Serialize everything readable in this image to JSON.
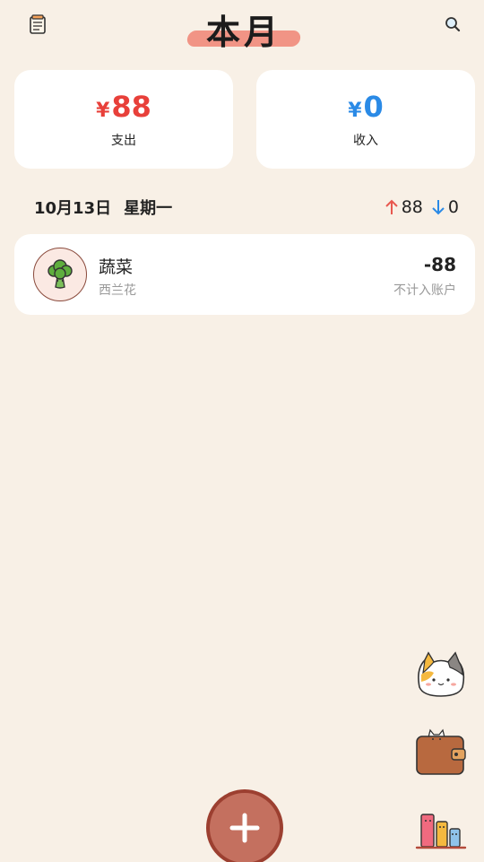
{
  "header": {
    "title": "本月",
    "menu_icon": "notebook-icon",
    "search_icon": "search-icon"
  },
  "summary": {
    "expense": {
      "currency": "¥",
      "amount": "88",
      "label": "支出",
      "color": "#e8403a"
    },
    "income": {
      "currency": "¥",
      "amount": "0",
      "label": "收入",
      "color": "#2a8ae6"
    }
  },
  "day": {
    "date": "10月13日",
    "weekday": "星期一",
    "expense_total": "88",
    "income_total": "0",
    "expense_arrow_color": "#e8584f",
    "income_arrow_color": "#2a8ae6"
  },
  "entries": [
    {
      "icon": "broccoli-icon",
      "category": "蔬菜",
      "note": "西兰花",
      "amount": "-88",
      "flag": "不计入账户"
    }
  ],
  "side_icons": [
    "cat-icon",
    "wallet-icon",
    "chart-icon"
  ],
  "add_button": {
    "icon": "plus-icon",
    "color": "#c4705f"
  },
  "theme": {
    "background": "#f8f0e6",
    "card": "#ffffff"
  }
}
